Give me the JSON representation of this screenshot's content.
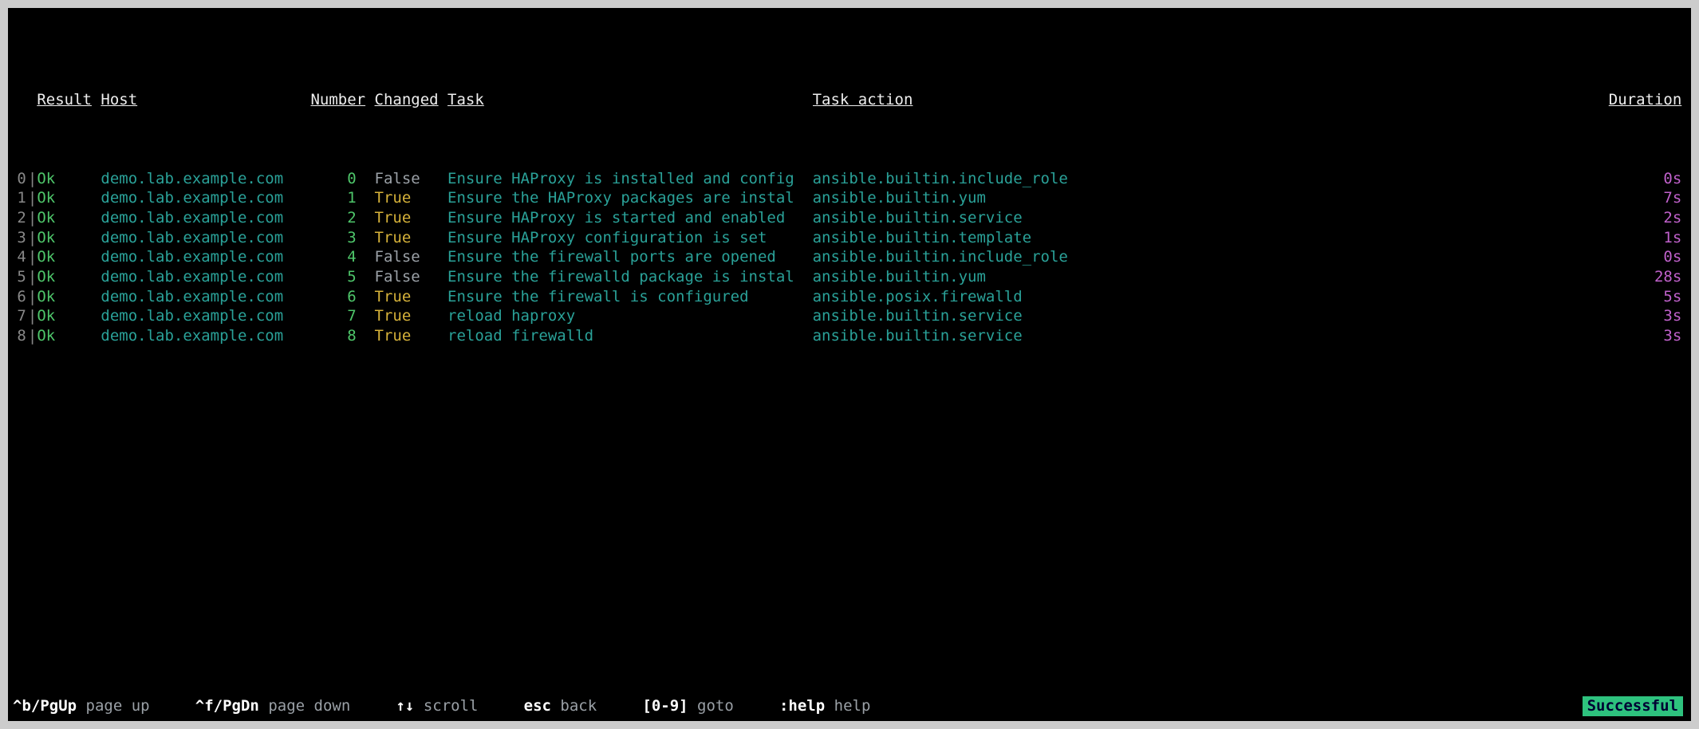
{
  "headers": {
    "result": "Result",
    "host": "Host",
    "number": "Number",
    "changed": "Changed",
    "task": "Task",
    "action": "Task action",
    "duration": "Duration"
  },
  "rows": [
    {
      "idx": "0",
      "result": "Ok",
      "host": "demo.lab.example.com",
      "number": "0",
      "changed": "False",
      "task": "Ensure HAProxy is installed and config",
      "action": "ansible.builtin.include_role",
      "duration": "0s"
    },
    {
      "idx": "1",
      "result": "Ok",
      "host": "demo.lab.example.com",
      "number": "1",
      "changed": "True",
      "task": "Ensure the HAProxy packages are instal",
      "action": "ansible.builtin.yum",
      "duration": "7s"
    },
    {
      "idx": "2",
      "result": "Ok",
      "host": "demo.lab.example.com",
      "number": "2",
      "changed": "True",
      "task": "Ensure HAProxy is started and enabled ",
      "action": "ansible.builtin.service",
      "duration": "2s"
    },
    {
      "idx": "3",
      "result": "Ok",
      "host": "demo.lab.example.com",
      "number": "3",
      "changed": "True",
      "task": "Ensure HAProxy configuration is set   ",
      "action": "ansible.builtin.template",
      "duration": "1s"
    },
    {
      "idx": "4",
      "result": "Ok",
      "host": "demo.lab.example.com",
      "number": "4",
      "changed": "False",
      "task": "Ensure the firewall ports are opened  ",
      "action": "ansible.builtin.include_role",
      "duration": "0s"
    },
    {
      "idx": "5",
      "result": "Ok",
      "host": "demo.lab.example.com",
      "number": "5",
      "changed": "False",
      "task": "Ensure the firewalld package is instal",
      "action": "ansible.builtin.yum",
      "duration": "28s"
    },
    {
      "idx": "6",
      "result": "Ok",
      "host": "demo.lab.example.com",
      "number": "6",
      "changed": "True",
      "task": "Ensure the firewall is configured     ",
      "action": "ansible.posix.firewalld",
      "duration": "5s"
    },
    {
      "idx": "7",
      "result": "Ok",
      "host": "demo.lab.example.com",
      "number": "7",
      "changed": "True",
      "task": "reload haproxy                        ",
      "action": "ansible.builtin.service",
      "duration": "3s"
    },
    {
      "idx": "8",
      "result": "Ok",
      "host": "demo.lab.example.com",
      "number": "8",
      "changed": "True",
      "task": "reload firewalld                      ",
      "action": "ansible.builtin.service",
      "duration": "3s"
    }
  ],
  "footer": {
    "pageup_key": "^b/PgUp",
    "pageup_lbl": "page up",
    "pagedn_key": "^f/PgDn",
    "pagedn_lbl": "page down",
    "scroll_key": "↑↓",
    "scroll_lbl": "scroll",
    "esc_key": "esc",
    "esc_lbl": "back",
    "goto_key": "[0-9]",
    "goto_lbl": "goto",
    "help_key": ":help",
    "help_lbl": "help",
    "status": "Successful"
  }
}
